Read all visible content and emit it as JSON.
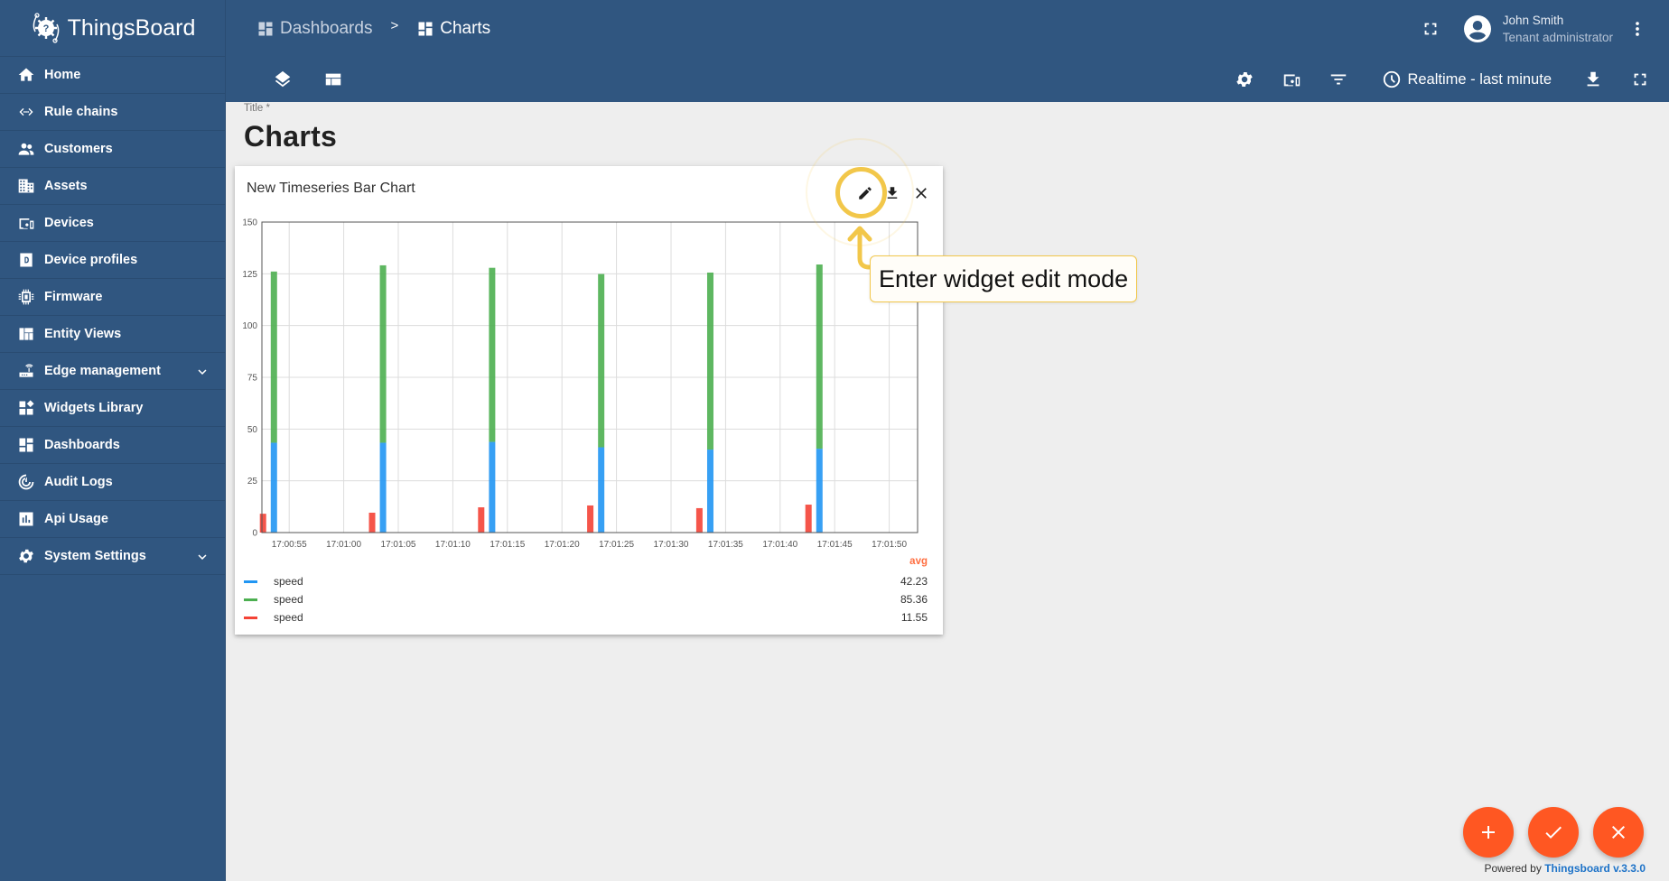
{
  "app": {
    "name": "ThingsBoard",
    "powered_by_prefix": "Powered by",
    "powered_by_link": "Thingsboard v.3.3.0"
  },
  "sidebar": {
    "items": [
      {
        "label": "Home",
        "icon": "home-icon"
      },
      {
        "label": "Rule chains",
        "icon": "rule-chains-icon"
      },
      {
        "label": "Customers",
        "icon": "customers-icon"
      },
      {
        "label": "Assets",
        "icon": "assets-icon"
      },
      {
        "label": "Devices",
        "icon": "devices-icon"
      },
      {
        "label": "Device profiles",
        "icon": "device-profiles-icon"
      },
      {
        "label": "Firmware",
        "icon": "firmware-icon"
      },
      {
        "label": "Entity Views",
        "icon": "entity-views-icon"
      },
      {
        "label": "Edge management",
        "icon": "edge-icon",
        "expandable": true
      },
      {
        "label": "Widgets Library",
        "icon": "widgets-icon"
      },
      {
        "label": "Dashboards",
        "icon": "dashboards-icon"
      },
      {
        "label": "Audit Logs",
        "icon": "audit-logs-icon"
      },
      {
        "label": "Api Usage",
        "icon": "api-usage-icon"
      },
      {
        "label": "System Settings",
        "icon": "settings-icon",
        "expandable": true
      }
    ]
  },
  "header": {
    "breadcrumb": [
      {
        "label": "Dashboards",
        "icon": "dashboards-icon"
      },
      {
        "label": "Charts",
        "icon": "dashboards-icon"
      }
    ],
    "breadcrumb_separator": ">",
    "user": {
      "name": "John Smith",
      "role": "Tenant administrator"
    }
  },
  "toolbar": {
    "timewindow_label": "Realtime - last minute"
  },
  "dashboard": {
    "title_label": "Title *",
    "title_value": "Charts"
  },
  "widget": {
    "title": "New Timeseries Bar Chart",
    "legend": {
      "header": "avg",
      "entries": [
        {
          "label": "speed",
          "color": "#2196f3",
          "avg": "42.23"
        },
        {
          "label": "speed",
          "color": "#4caf50",
          "avg": "85.36"
        },
        {
          "label": "speed",
          "color": "#f44336",
          "avg": "11.55"
        }
      ]
    }
  },
  "tooltip": {
    "text": "Enter widget edit mode",
    "highlight_color": "#f2c74a"
  },
  "colors": {
    "primary": "#305680",
    "accent": "#ff5722"
  },
  "chart_data": {
    "type": "bar",
    "stacked": true,
    "title": "New Timeseries Bar Chart",
    "xlabel": "",
    "ylabel": "",
    "ylim": [
      0,
      150
    ],
    "yticks": [
      0,
      25,
      50,
      75,
      100,
      125,
      150
    ],
    "xlim_seconds": [
      "17:00:52.5",
      "17:01:52.6"
    ],
    "xtick_labels": [
      "17:00:55",
      "17:01:00",
      "17:01:05",
      "17:01:10",
      "17:01:15",
      "17:01:20",
      "17:01:25",
      "17:01:30",
      "17:01:35",
      "17:01:40",
      "17:01:45",
      "17:01:50"
    ],
    "grid": true,
    "legend_position": "bottom",
    "series": [
      {
        "name": "speed",
        "color": "#f44336",
        "stack": "a",
        "x": [
          "17:00:52.6",
          "17:01:02.6",
          "17:01:12.6",
          "17:01:22.6",
          "17:01:32.6",
          "17:01:42.6"
        ],
        "values": [
          9.1,
          9.6,
          12.2,
          13.1,
          11.8,
          13.5
        ]
      },
      {
        "name": "speed",
        "color": "#2196f3",
        "stack": "b",
        "x": [
          "17:00:53.6",
          "17:01:03.6",
          "17:01:13.6",
          "17:01:23.6",
          "17:01:33.6",
          "17:01:43.6"
        ],
        "values": [
          43.4,
          43.4,
          43.8,
          41.2,
          40.1,
          40.5
        ]
      },
      {
        "name": "speed",
        "color": "#4caf50",
        "stack": "b",
        "x": [
          "17:00:53.6",
          "17:01:03.6",
          "17:01:13.6",
          "17:01:23.6",
          "17:01:33.6",
          "17:01:43.6"
        ],
        "values": [
          82.7,
          85.7,
          84.1,
          83.7,
          85.5,
          89.0
        ]
      }
    ]
  }
}
